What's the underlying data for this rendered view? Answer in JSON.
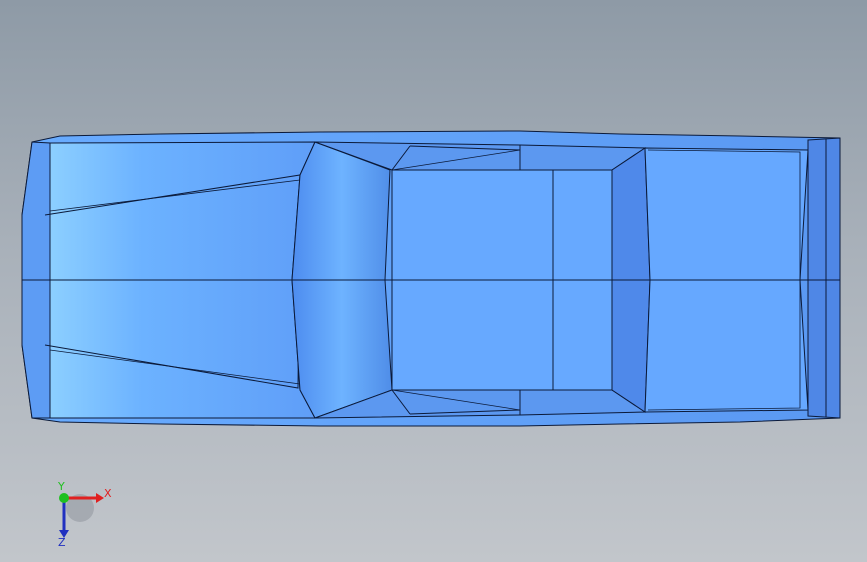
{
  "viewport": {
    "background_top": "#8e9aa6",
    "background_bottom": "#c2c6cb"
  },
  "model": {
    "name": "car-body-top-view",
    "face_color": "#66a6ff",
    "face_dark": "#4f86e6",
    "face_light": "#88c8ff",
    "edge_color": "#0b1a3a"
  },
  "triad": {
    "x_label": "X",
    "y_label": "Y",
    "z_label": "Z",
    "x_color": "#e02020",
    "y_color": "#20c020",
    "z_color": "#2030c0"
  }
}
